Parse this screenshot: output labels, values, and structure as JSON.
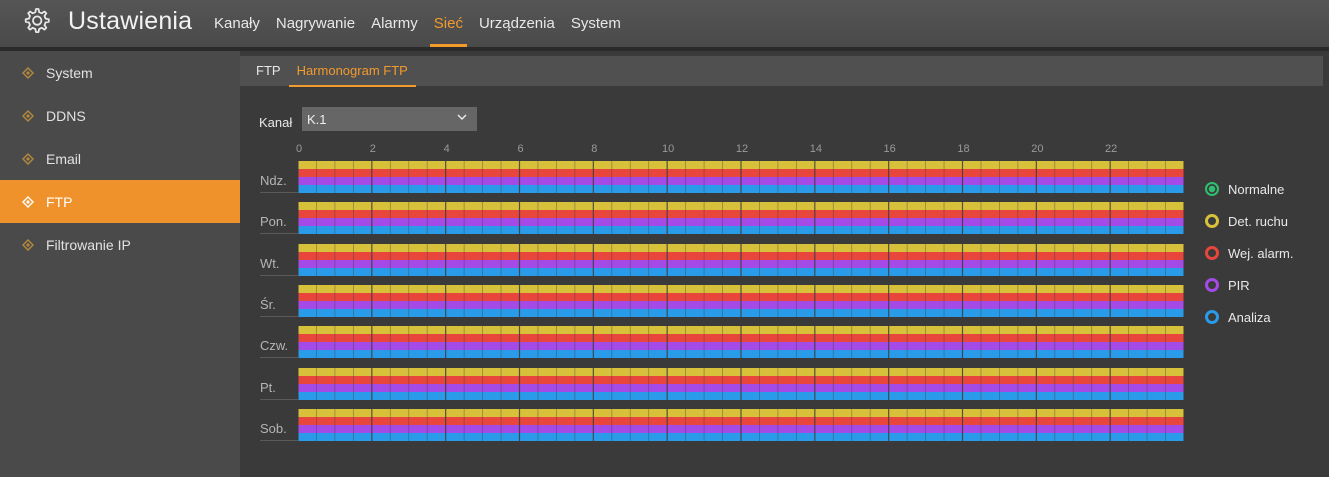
{
  "header": {
    "title": "Ustawienia",
    "icon": "gear-icon",
    "tabs": [
      {
        "label": "Kanały",
        "active": false
      },
      {
        "label": "Nagrywanie",
        "active": false
      },
      {
        "label": "Alarmy",
        "active": false
      },
      {
        "label": "Sieć",
        "active": true
      },
      {
        "label": "Urządzenia",
        "active": false
      },
      {
        "label": "System",
        "active": false
      }
    ]
  },
  "sidebar": {
    "items": [
      {
        "label": "System",
        "active": false
      },
      {
        "label": "DDNS",
        "active": false
      },
      {
        "label": "Email",
        "active": false
      },
      {
        "label": "FTP",
        "active": true
      },
      {
        "label": "Filtrowanie IP",
        "active": false
      }
    ]
  },
  "subtabs": [
    {
      "label": "FTP",
      "active": false
    },
    {
      "label": "Harmonogram FTP",
      "active": true
    }
  ],
  "channel": {
    "label": "Kanał",
    "value": "K.1"
  },
  "schedule": {
    "hour_labels": [
      "0",
      "2",
      "4",
      "6",
      "8",
      "10",
      "12",
      "14",
      "16",
      "18",
      "20",
      "22"
    ],
    "days": [
      "Ndz.",
      "Pon.",
      "Wt.",
      "Śr.",
      "Czw.",
      "Pt.",
      "Sob."
    ],
    "slots_per_day": 48
  },
  "legend": [
    {
      "label": "Normalne",
      "color": "#2fbf71"
    },
    {
      "label": "Det. ruchu",
      "color": "#d8c13a"
    },
    {
      "label": "Wej. alarm.",
      "color": "#e8463c"
    },
    {
      "label": "PIR",
      "color": "#a44ae6"
    },
    {
      "label": "Analiza",
      "color": "#2a9be8"
    }
  ],
  "colors": {
    "accent": "#f0922b",
    "yellow": "#d8c13a",
    "red": "#e8463c",
    "purple": "#a44ae6",
    "blue": "#2a9be8"
  }
}
